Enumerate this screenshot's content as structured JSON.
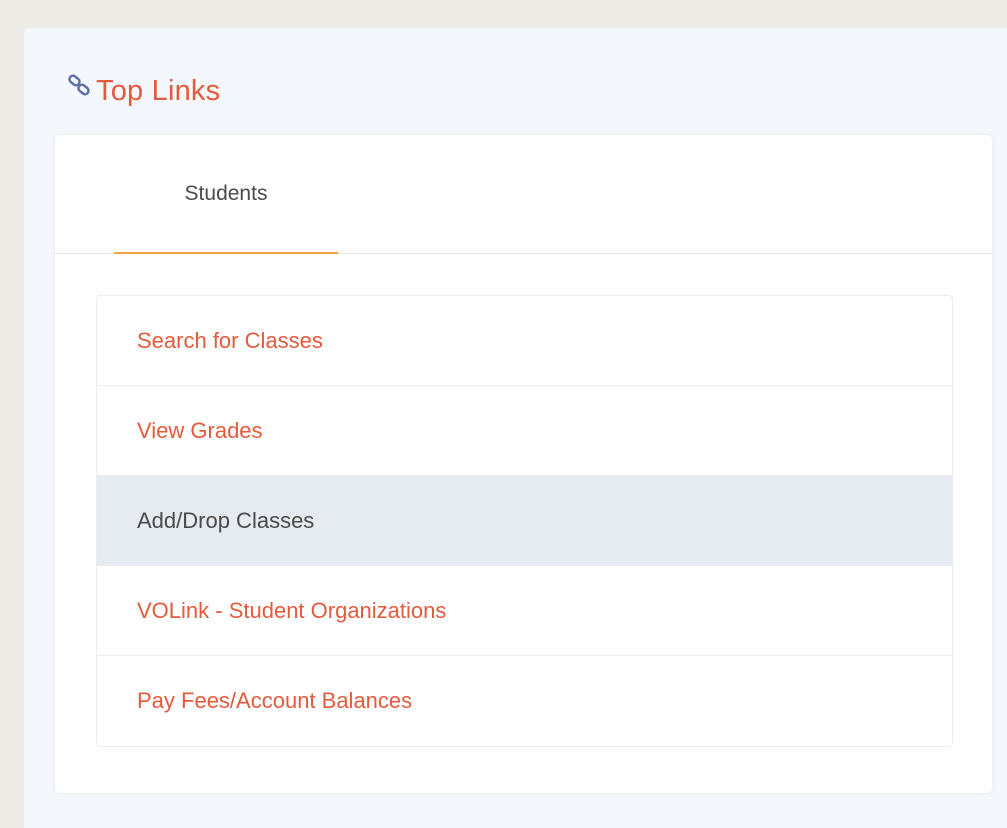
{
  "panel": {
    "title": "Top Links",
    "icon": "link-icon"
  },
  "tabs": [
    {
      "label": "Students",
      "active": true
    }
  ],
  "links": [
    {
      "label": "Search for Classes",
      "active": false
    },
    {
      "label": "View Grades",
      "active": false
    },
    {
      "label": "Add/Drop Classes",
      "active": true
    },
    {
      "label": "VOLink - Student Organizations",
      "active": false
    },
    {
      "label": "Pay Fees/Account Balances",
      "active": false
    }
  ],
  "colors": {
    "accent": "#e45a3d",
    "tab_underline": "#f0a23c",
    "active_row": "#e6ebf2",
    "icon": "#5b6fa8"
  }
}
